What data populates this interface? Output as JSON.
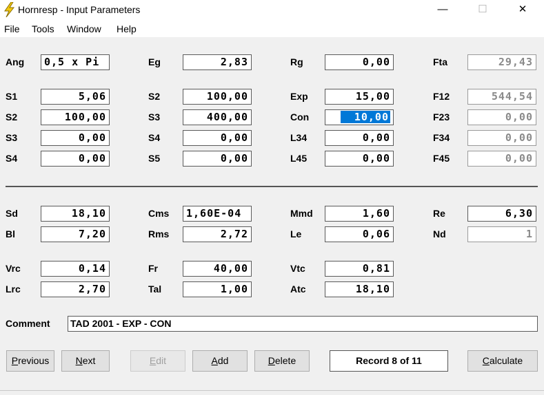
{
  "window": {
    "title": "Hornresp - Input Parameters",
    "minimize": "—",
    "maximize": "☐",
    "close": "✕"
  },
  "menu": [
    "File",
    "Tools",
    "Window",
    "Help"
  ],
  "horn": {
    "ang": {
      "label": "Ang",
      "value": "0,5 x Pi"
    },
    "eg": {
      "label": "Eg",
      "value": "2,83"
    },
    "rg": {
      "label": "Rg",
      "value": "0,00"
    },
    "fta": {
      "label": "Fta",
      "value": "29,43"
    },
    "c1": [
      {
        "label": "S1",
        "value": "5,06"
      },
      {
        "label": "S2",
        "value": "100,00"
      },
      {
        "label": "S3",
        "value": "0,00"
      },
      {
        "label": "S4",
        "value": "0,00"
      }
    ],
    "c2": [
      {
        "label": "S2",
        "value": "100,00"
      },
      {
        "label": "S3",
        "value": "400,00"
      },
      {
        "label": "S4",
        "value": "0,00"
      },
      {
        "label": "S5",
        "value": "0,00"
      }
    ],
    "c3": [
      {
        "label": "Exp",
        "value": "15,00"
      },
      {
        "label": "Con",
        "value": "10,00"
      },
      {
        "label": "L34",
        "value": "0,00"
      },
      {
        "label": "L45",
        "value": "0,00"
      }
    ],
    "c4": [
      {
        "label": "F12",
        "value": "544,54"
      },
      {
        "label": "F23",
        "value": "0,00"
      },
      {
        "label": "F34",
        "value": "0,00"
      },
      {
        "label": "F45",
        "value": "0,00"
      }
    ]
  },
  "driver": {
    "sd": {
      "label": "Sd",
      "value": "18,10"
    },
    "bl": {
      "label": "Bl",
      "value": "7,20"
    },
    "cms": {
      "label": "Cms",
      "value": "1,60E-04"
    },
    "rms": {
      "label": "Rms",
      "value": "2,72"
    },
    "mmd": {
      "label": "Mmd",
      "value": "1,60"
    },
    "le": {
      "label": "Le",
      "value": "0,06"
    },
    "re": {
      "label": "Re",
      "value": "6,30"
    },
    "nd": {
      "label": "Nd",
      "value": "1"
    },
    "vrc": {
      "label": "Vrc",
      "value": "0,14"
    },
    "lrc": {
      "label": "Lrc",
      "value": "2,70"
    },
    "fr": {
      "label": "Fr",
      "value": "40,00"
    },
    "tal": {
      "label": "Tal",
      "value": "1,00"
    },
    "vtc": {
      "label": "Vtc",
      "value": "0,81"
    },
    "atc": {
      "label": "Atc",
      "value": "18,10"
    }
  },
  "comment": {
    "label": "Comment",
    "value": "TAD 2001 - EXP - CON"
  },
  "buttons": {
    "previous_hot": "P",
    "previous_rest": "revious",
    "next_hot": "N",
    "next_rest": "ext",
    "edit_hot": "E",
    "edit_rest": "dit",
    "add_hot": "A",
    "add_rest": "dd",
    "delete_hot": "D",
    "delete_rest": "elete",
    "calculate_hot": "C",
    "calculate_rest": "alculate"
  },
  "record": "Record 8 of 11",
  "colors": {
    "selection": "#0078d7",
    "icon": "#f2c811"
  }
}
